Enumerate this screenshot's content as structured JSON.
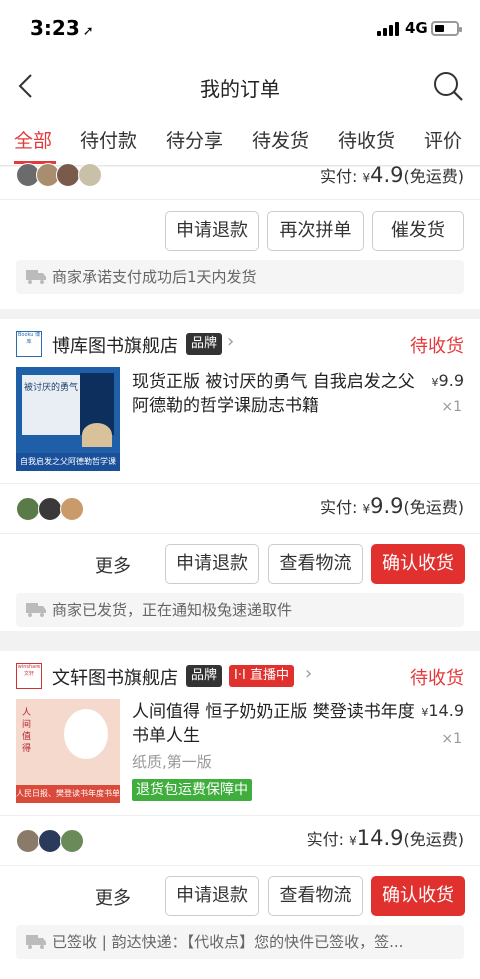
{
  "status_bar": {
    "time": "3:23",
    "network": "4G"
  },
  "nav": {
    "title": "我的订单"
  },
  "tabs": [
    "全部",
    "待付款",
    "待分享",
    "待发货",
    "待收货",
    "评价"
  ],
  "orders": [
    {
      "paid_label": "实付:",
      "paid_amount": "4.9",
      "shipping_note": "(免运费)",
      "actions": [
        "申请退款",
        "再次拼单",
        "催发货"
      ],
      "notice": "商家承诺支付成功后1天内发货"
    },
    {
      "shop_logo": "Booku 博库",
      "shop_name": "博库图书旗舰店",
      "brand_badge": "品牌",
      "status": "待收货",
      "product_title": "现货正版 被讨厌的勇气 自我启发之父阿德勒的哲学课励志书籍",
      "price": "9.9",
      "qty": "×1",
      "thumb_title": "被讨厌的勇气",
      "thumb_caption": "自我启发之父阿德勒哲学课",
      "paid_label": "实付:",
      "paid_amount": "9.9",
      "shipping_note": "(免运费)",
      "more": "更多",
      "actions": [
        "申请退款",
        "查看物流",
        "确认收货"
      ],
      "notice": "商家已发货，正在通知极兔速递取件"
    },
    {
      "shop_logo": "winshare 文轩",
      "shop_name": "文轩图书旗舰店",
      "brand_badge": "品牌",
      "live_badge": "直播中",
      "status": "待收货",
      "product_title": "人间值得 恒子奶奶正版 樊登读书年度书单人生",
      "price": "14.9",
      "qty": "×1",
      "spec": "纸质,第一版",
      "guarantee": "退货包运费保障中",
      "thumb_title": "人间值得",
      "thumb_caption": "人民日报、樊登读书年度书单",
      "paid_label": "实付:",
      "paid_amount": "14.9",
      "shipping_note": "(免运费)",
      "more": "更多",
      "actions": [
        "申请退款",
        "查看物流",
        "确认收货"
      ],
      "notice": "已签收 | 韵达快递：【代收点】您的快件已签收，签..."
    }
  ],
  "colors": {
    "accent": "#e4393c",
    "confirm_button": "#e0312f",
    "guarantee": "#3fae3d"
  }
}
